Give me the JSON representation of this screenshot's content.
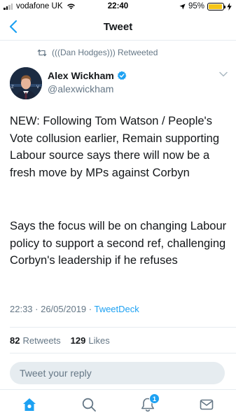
{
  "status_bar": {
    "carrier": "vodafone UK",
    "time": "22:40",
    "battery": "95%",
    "battery_level": 0.95
  },
  "nav": {
    "title": "Tweet"
  },
  "retweet": {
    "text": "(((Dan Hodges))) Retweeted"
  },
  "author": {
    "name": "Alex Wickham",
    "handle": "@alexwickham",
    "verified": true
  },
  "tweet": {
    "paragraph1": "NEW: Following Tom Watson / People's Vote collusion earlier, Remain supporting Labour source says there will now be a fresh move by MPs against Corbyn",
    "paragraph2": "Says the focus will be on changing Labour policy to support a second ref, challenging Corbyn's leadership if he refuses",
    "timestamp": "22:33 · 26/05/2019 · ",
    "source": "TweetDeck"
  },
  "stats": {
    "retweets_count": "82",
    "retweets_label": "Retweets",
    "likes_count": "129",
    "likes_label": "Likes"
  },
  "reply": {
    "placeholder": "Tweet your reply"
  },
  "tab_bar": {
    "notification_count": "1"
  },
  "colors": {
    "accent": "#1da1f2",
    "text": "#14171a",
    "secondary": "#657786",
    "battery": "#f5c518"
  }
}
